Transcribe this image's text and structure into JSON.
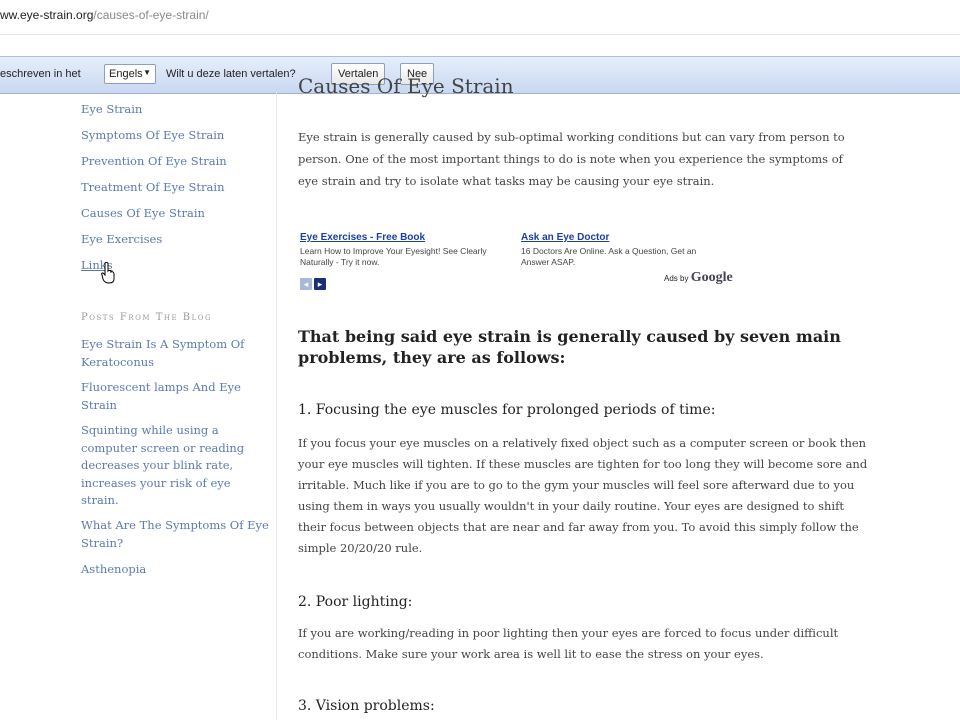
{
  "browser": {
    "url_domain": "ww.eye-strain.org",
    "url_path": "/causes-of-eye-strain/"
  },
  "translate_bar": {
    "written_in": "eschreven in het",
    "language": "Engels",
    "question": "Wilt u deze laten vertalen?",
    "translate_button": "Vertalen",
    "no_button": "Nee"
  },
  "sidebar": {
    "links": [
      "Eye Strain",
      "Symptoms Of Eye Strain",
      "Prevention Of Eye Strain",
      "Treatment Of Eye Strain",
      "Causes Of Eye Strain",
      "Eye Exercises",
      "Links"
    ],
    "blog_heading": "Posts From The Blog",
    "blog_posts": [
      "Eye Strain Is A Symptom Of Keratoconus",
      "Fluorescent lamps And Eye Strain",
      "Squinting while using a computer screen or reading decreases your blink rate, increases your risk of eye strain.",
      "What Are The Symptoms Of Eye Strain?",
      "Asthenopia"
    ]
  },
  "main": {
    "title": "Causes Of Eye Strain",
    "intro": "Eye strain is generally caused by sub-optimal working conditions but can vary from person to person. One of the most important things to do is note when you experience the symptoms of eye strain and try to isolate what tasks may be causing your eye strain.",
    "ads": [
      {
        "title": "Eye Exercises - Free Book",
        "desc": "Learn How to Improve Your Eyesight! See Clearly Naturally - Try it now."
      },
      {
        "title": "Ask an Eye Doctor",
        "desc": "16 Doctors Are Online. Ask a Question, Get an Answer ASAP."
      }
    ],
    "ads_by": "Ads by",
    "ads_brand": "Google",
    "subheading": "That being said eye strain is generally caused by seven main problems, they are as follows:",
    "sections": [
      {
        "heading": "1. Focusing the eye muscles for prolonged periods of time:",
        "text": "If you focus your eye muscles on a relatively fixed object such as a computer screen or book then your eye muscles will tighten. If these muscles are tighten for too long they will become sore and irritable. Much like if you are to go to the gym your muscles will feel sore afterward due to you using them in ways you usually wouldn't in your daily routine. Your eyes are designed to shift their focus between objects that are near and far away from you. To avoid this simply follow the simple 20/20/20 rule."
      },
      {
        "heading": "2. Poor lighting:",
        "text": "If you are working/reading in poor lighting then your eyes are forced to focus under difficult conditions. Make sure your work area is well lit to ease the stress on your eyes."
      },
      {
        "heading": "3. Vision problems:",
        "text": ""
      }
    ]
  },
  "colors": {
    "link": "#5b7ab0",
    "ad_link": "#1a3fa0",
    "translate_bar": "#c9d8f1"
  }
}
